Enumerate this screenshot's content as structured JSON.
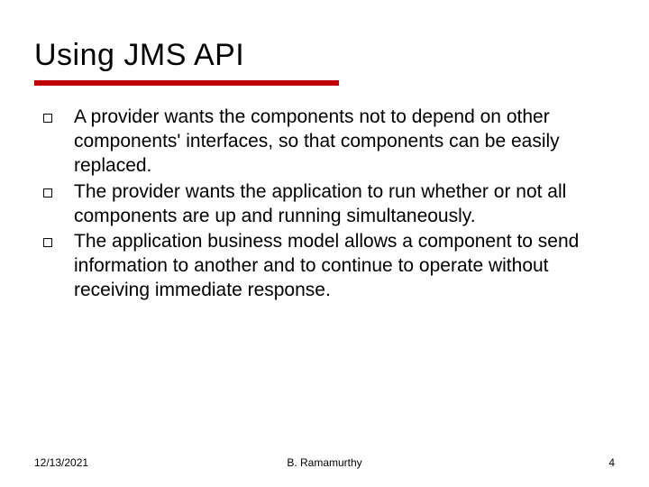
{
  "title": "Using JMS API",
  "bullets": [
    "A provider wants the components not to depend on other components' interfaces, so that components can be easily replaced.",
    "The provider wants the application to run whether or not all components are up and running simultaneously.",
    "The application business model allows a component to send information to another and to continue to operate without receiving immediate response."
  ],
  "footer": {
    "date": "12/13/2021",
    "author": "B. Ramamurthy",
    "page": "4"
  }
}
